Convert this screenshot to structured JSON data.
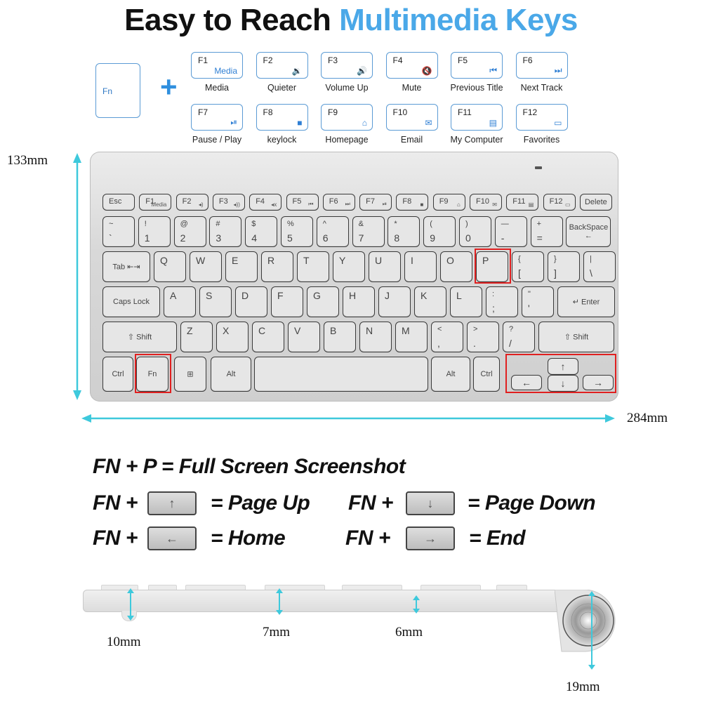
{
  "title": {
    "main": "Easy to Reach ",
    "accent": "Multimedia Keys",
    "accent_color": "#4aa8e8"
  },
  "fn_legend": {
    "fn_label": "Fn",
    "plus": "+",
    "keys": [
      {
        "key": "F1",
        "icon_text": "Media",
        "icon": "media-text",
        "caption": "Media"
      },
      {
        "key": "F2",
        "icon_text": "🔉",
        "icon": "volume-down-icon",
        "caption": "Quieter"
      },
      {
        "key": "F3",
        "icon_text": "🔊",
        "icon": "volume-up-icon",
        "caption": "Volume Up"
      },
      {
        "key": "F4",
        "icon_text": "🔇",
        "icon": "mute-icon",
        "caption": "Mute"
      },
      {
        "key": "F5",
        "icon_text": "⏮",
        "icon": "previous-track-icon",
        "caption": "Previous Title"
      },
      {
        "key": "F6",
        "icon_text": "⏭",
        "icon": "next-track-icon",
        "caption": "Next Track"
      },
      {
        "key": "F7",
        "icon_text": "⏯",
        "icon": "play-pause-icon",
        "caption": "Pause / Play"
      },
      {
        "key": "F8",
        "icon_text": "■",
        "icon": "keylock-icon",
        "caption": "keylock"
      },
      {
        "key": "F9",
        "icon_text": "⌂",
        "icon": "home-icon",
        "caption": "Homepage"
      },
      {
        "key": "F10",
        "icon_text": "✉",
        "icon": "email-icon",
        "caption": "Email"
      },
      {
        "key": "F11",
        "icon_text": "▤",
        "icon": "computer-icon",
        "caption": "My Computer"
      },
      {
        "key": "F12",
        "icon_text": "▭",
        "icon": "folder-icon",
        "caption": "Favorites"
      }
    ]
  },
  "keyboard": {
    "row_f": [
      {
        "t": "Esc"
      },
      {
        "t": "F1",
        "s": "Media"
      },
      {
        "t": "F2",
        "s": "◂)"
      },
      {
        "t": "F3",
        "s": "◂))"
      },
      {
        "t": "F4",
        "s": "◂x"
      },
      {
        "t": "F5",
        "s": "⏮"
      },
      {
        "t": "F6",
        "s": "⏭"
      },
      {
        "t": "F7",
        "s": "⏯"
      },
      {
        "t": "F8",
        "s": "■"
      },
      {
        "t": "F9",
        "s": "⌂"
      },
      {
        "t": "F10",
        "s": "✉"
      },
      {
        "t": "F11",
        "s": "▤"
      },
      {
        "t": "F12",
        "s": "▭"
      },
      {
        "c": "Delete"
      }
    ],
    "row_num": [
      {
        "t": "~",
        "b": "`"
      },
      {
        "t": "!",
        "b": "1"
      },
      {
        "t": "@",
        "b": "2"
      },
      {
        "t": "#",
        "b": "3"
      },
      {
        "t": "$",
        "b": "4"
      },
      {
        "t": "%",
        "b": "5"
      },
      {
        "t": "^",
        "b": "6"
      },
      {
        "t": "&",
        "b": "7"
      },
      {
        "t": "*",
        "b": "8"
      },
      {
        "t": "(",
        "b": "9"
      },
      {
        "t": ")",
        "b": "0"
      },
      {
        "t": "—",
        "b": "-"
      },
      {
        "t": "+",
        "b": "="
      },
      {
        "c": "BackSpace ←"
      }
    ],
    "row_q": [
      {
        "c": "Tab ⇤⇥"
      },
      {
        "t": "Q"
      },
      {
        "t": "W"
      },
      {
        "t": "E"
      },
      {
        "t": "R"
      },
      {
        "t": "T"
      },
      {
        "t": "Y"
      },
      {
        "t": "U"
      },
      {
        "t": "I"
      },
      {
        "t": "O"
      },
      {
        "t": "P"
      },
      {
        "t": "{",
        "b": "["
      },
      {
        "t": "}",
        "b": "]"
      },
      {
        "t": "|",
        "b": "\\"
      }
    ],
    "row_a": [
      {
        "c": "Caps Lock"
      },
      {
        "t": "A"
      },
      {
        "t": "S"
      },
      {
        "t": "D"
      },
      {
        "t": "F"
      },
      {
        "t": "G"
      },
      {
        "t": "H"
      },
      {
        "t": "J"
      },
      {
        "t": "K"
      },
      {
        "t": "L"
      },
      {
        "t": ":",
        "b": ";"
      },
      {
        "t": "\"",
        "b": "'"
      },
      {
        "c": "↵ Enter"
      }
    ],
    "row_z": [
      {
        "c": "⇧ Shift"
      },
      {
        "t": "Z"
      },
      {
        "t": "X"
      },
      {
        "t": "C"
      },
      {
        "t": "V"
      },
      {
        "t": "B"
      },
      {
        "t": "N"
      },
      {
        "t": "M"
      },
      {
        "t": "<",
        "b": ","
      },
      {
        "t": ">",
        "b": "."
      },
      {
        "t": "?",
        "b": "/"
      },
      {
        "c": "⇧ Shift"
      }
    ],
    "row_bottom": [
      {
        "c": "Ctrl"
      },
      {
        "c": "Fn"
      },
      {
        "c": "⊞"
      },
      {
        "c": "Alt"
      },
      {
        "c": ""
      },
      {
        "c": "Alt"
      },
      {
        "c": "Ctrl"
      }
    ],
    "arrows": {
      "left": "←",
      "up": "↑",
      "down": "↓",
      "right": "→"
    }
  },
  "dimensions": {
    "height": "133mm",
    "width": "284mm",
    "side": [
      "10mm",
      "7mm",
      "6mm",
      "19mm"
    ]
  },
  "shortcuts": {
    "line1": "FN + P = Full Screen Screenshot",
    "items": [
      {
        "prefix": "FN +",
        "key": "↑",
        "result": "=  Page Up"
      },
      {
        "prefix": "FN +",
        "key": "↓",
        "result": "=  Page Down"
      },
      {
        "prefix": "FN +",
        "key": "←",
        "result": "=  Home"
      },
      {
        "prefix": "FN +",
        "key": "→",
        "result": "=  End"
      }
    ]
  }
}
